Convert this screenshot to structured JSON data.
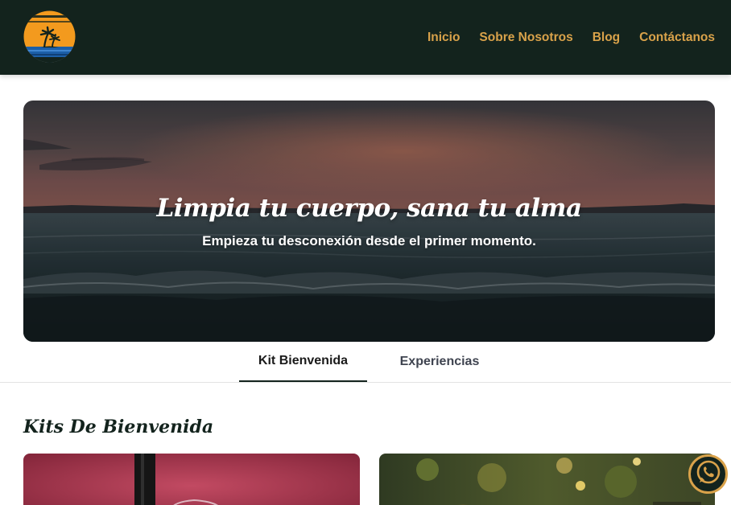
{
  "nav": {
    "logo_icon": "palm-sunset-logo-icon",
    "links": [
      {
        "label": "Inicio"
      },
      {
        "label": "Sobre Nosotros"
      },
      {
        "label": "Blog"
      },
      {
        "label": "Contáctanos"
      }
    ]
  },
  "hero": {
    "title": "Limpia tu cuerpo, sana tu alma",
    "subtitle": "Empieza tu desconexión desde el primer momento."
  },
  "tabs": [
    {
      "label": "Kit Bienvenida",
      "active": true
    },
    {
      "label": "Experiencias",
      "active": false
    }
  ],
  "section": {
    "title": "Kits De Bienvenida"
  },
  "cards": [
    {
      "image": "wine-bottle-glass-photo"
    },
    {
      "image": "garden-food-photo"
    }
  ],
  "whatsapp": {
    "icon": "whatsapp-icon"
  },
  "colors": {
    "nav_bg": "#13231d",
    "accent": "#d9a24a",
    "text_dark": "#13231d"
  }
}
